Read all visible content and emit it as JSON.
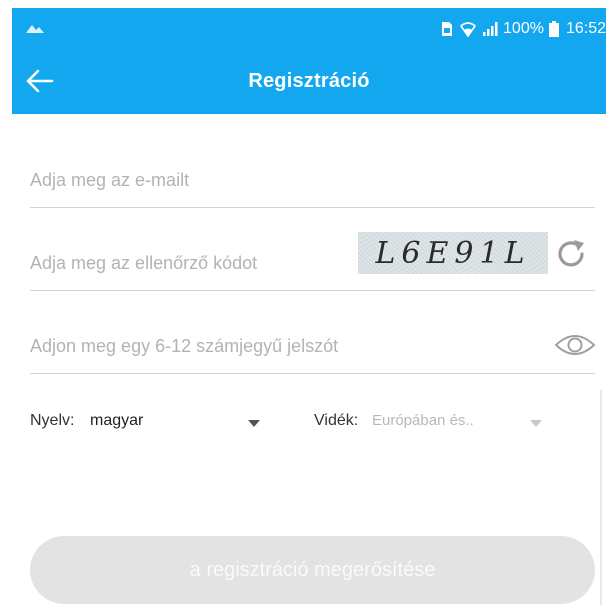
{
  "status_bar": {
    "battery": "100%",
    "time": "16:52"
  },
  "app_bar": {
    "title": "Regisztráció",
    "back_icon": "arrow-left-icon"
  },
  "form": {
    "email_placeholder": "Adja meg az e-mailt",
    "code_placeholder": "Adja meg az ellenőrző kódot",
    "captcha_text": "L6E91L",
    "password_placeholder": "Adjon meg egy 6-12 számjegyű jelszót"
  },
  "selectors": {
    "language_label": "Nyelv:",
    "language_value": "magyar",
    "region_label": "Vidék:",
    "region_value": "Európában és.."
  },
  "buttons": {
    "confirm_label": "a regisztráció megerősítése"
  },
  "colors": {
    "accent": "#13a7f0",
    "button_disabled": "#e3e3e3"
  }
}
